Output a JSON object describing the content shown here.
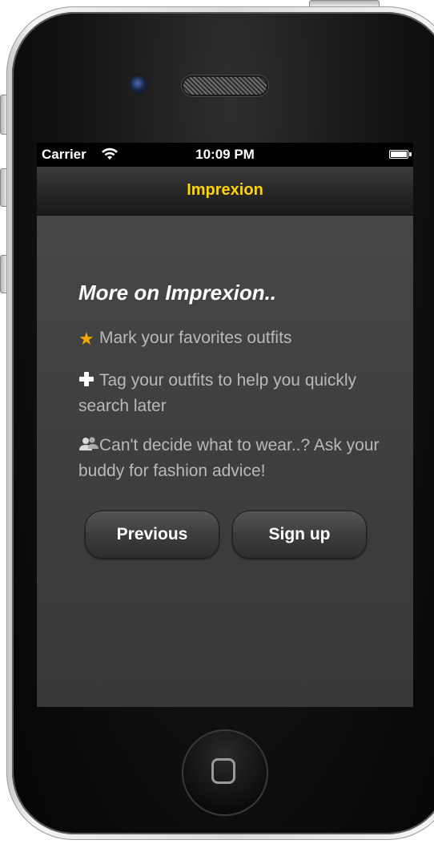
{
  "status_bar": {
    "carrier": "Carrier",
    "time": "10:09 PM",
    "wifi_icon": "wifi-icon",
    "battery_icon": "battery-icon"
  },
  "nav_bar": {
    "title": "Imprexion"
  },
  "content": {
    "heading": "More on Imprexion..",
    "features": [
      {
        "icon": "star-icon",
        "text": "Mark your favorites outfits"
      },
      {
        "icon": "plus-icon",
        "text": "Tag your outfits to help you quickly search later"
      },
      {
        "icon": "people-icon",
        "text": "Can't decide what to wear..? Ask your buddy for fashion advice!"
      }
    ],
    "buttons": {
      "previous": "Previous",
      "signup": "Sign up"
    }
  },
  "colors": {
    "title_yellow": "#ffd300",
    "star_orange": "#f5a800",
    "feature_text": "#b9b9b9"
  }
}
